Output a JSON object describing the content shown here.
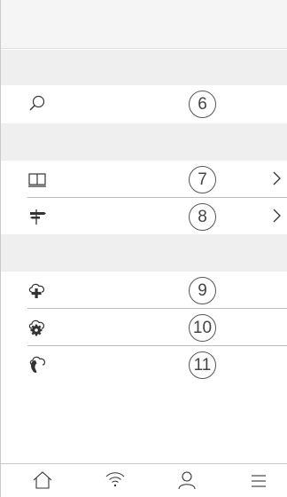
{
  "badges": {
    "search": "6",
    "manual": "7",
    "directions": "8",
    "cloud_add": "9",
    "cloud_settings": "10",
    "cloud_hearing": "11"
  },
  "icons": {
    "search": "search-icon",
    "manual": "book-icon",
    "directions": "signpost-icon",
    "cloud_add": "cloud-plus-icon",
    "cloud_settings": "cloud-gear-icon",
    "cloud_hearing": "cloud-hearing-aid-icon",
    "tab_home": "home-icon",
    "tab_wifi": "wifi-icon",
    "tab_profile": "user-icon",
    "tab_menu": "menu-icon"
  },
  "colors": {
    "header_bg": "#f5f5f5",
    "section_bg": "#efefef",
    "line": "#bdbdbd",
    "icon": "#333333"
  }
}
